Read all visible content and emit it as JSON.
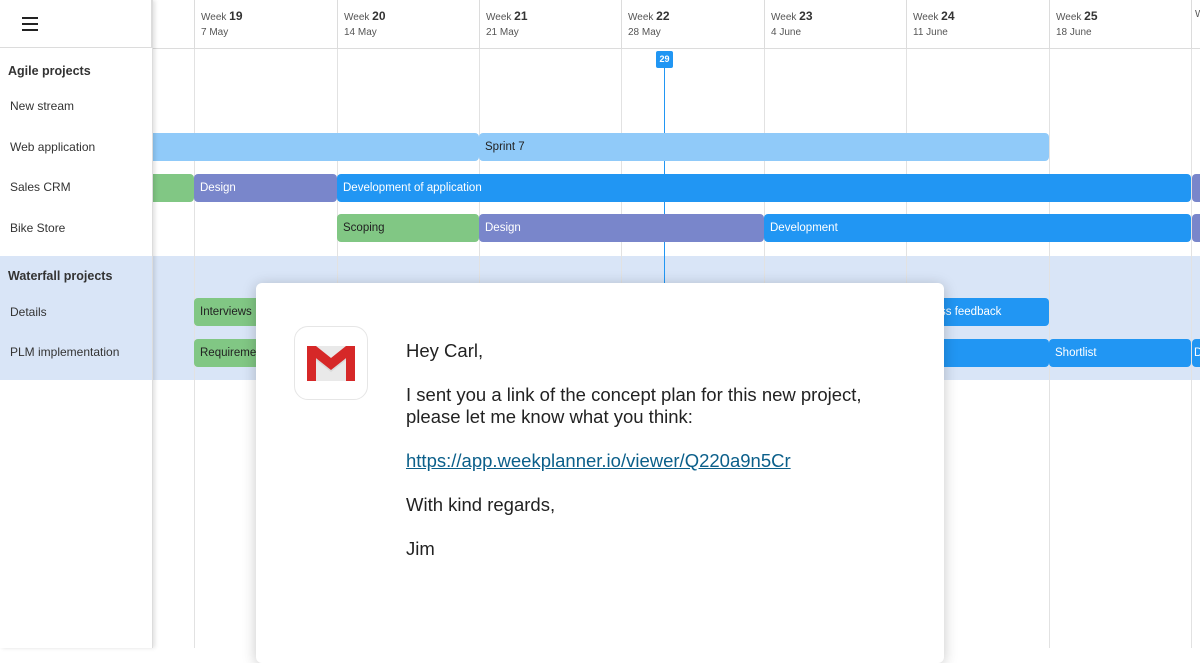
{
  "menu_icon": "hamburger-menu-icon",
  "weeks": [
    {
      "label": "Week",
      "num": "19",
      "date": "7 May"
    },
    {
      "label": "Week",
      "num": "20",
      "date": "14 May"
    },
    {
      "label": "Week",
      "num": "21",
      "date": "21 May"
    },
    {
      "label": "Week",
      "num": "22",
      "date": "28 May"
    },
    {
      "label": "Week",
      "num": "23",
      "date": "4 June"
    },
    {
      "label": "Week",
      "num": "24",
      "date": "11 June"
    },
    {
      "label": "Week",
      "num": "25",
      "date": "18 June"
    },
    {
      "label": "W",
      "num": "",
      "date": ""
    }
  ],
  "today_badge": "29",
  "groups": {
    "agile": {
      "title": "Agile projects",
      "rows": [
        "New stream",
        "Web application",
        "Sales CRM",
        "Bike Store"
      ]
    },
    "waterfall": {
      "title": "Waterfall projects",
      "rows": [
        "Details",
        "PLM implementation"
      ]
    }
  },
  "bars": {
    "web_app_prev": "",
    "sprint7": "Sprint 7",
    "crm_prev": "",
    "crm_design": "Design",
    "crm_dev": "Development of application",
    "bike_scoping": "Scoping",
    "bike_design": "Design",
    "bike_dev": "Development",
    "details_interviews": "Interviews",
    "details_feedback": "ss feedback",
    "plm_requirements": "Requiremen",
    "plm_blue": "",
    "plm_shortlist": "Shortlist",
    "plm_edge": "D"
  },
  "colors": {
    "light_blue": "#90caf9",
    "blue": "#2196f3",
    "purple": "#7986cb",
    "green": "#81c784",
    "waterfall_bg": "#d9e5f7"
  },
  "email": {
    "icon": "gmail-icon",
    "greeting": "Hey Carl,",
    "line1": "I sent you a link of the concept plan for this new project,",
    "line2": "please let me know what you think:",
    "link": "https://app.weekplanner.io/viewer/Q220a9n5Cr",
    "closing": "With kind regards,",
    "signature": "Jim"
  }
}
